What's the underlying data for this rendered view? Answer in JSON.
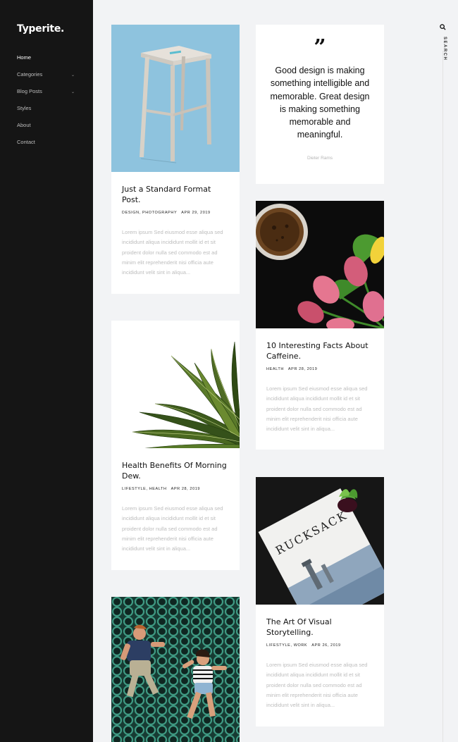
{
  "brand": {
    "logo": "Typerite."
  },
  "nav": [
    {
      "label": "Home",
      "active": true
    },
    {
      "label": "Categories",
      "chevron": "⌄"
    },
    {
      "label": "Blog Posts",
      "chevron": "⌄"
    },
    {
      "label": "Styles"
    },
    {
      "label": "About"
    },
    {
      "label": "Contact"
    }
  ],
  "search": {
    "label": "SEARCH",
    "icon": "search-icon"
  },
  "posts": [
    {
      "title": "Just a Standard Format Post.",
      "categories": "DESIGN, PHOTOGRAPHY",
      "date": "APR 29, 2019",
      "excerpt": "Lorem ipsum Sed eiusmod esse aliqua sed incididunt aliqua incididunt mollit id et sit proident dolor nulla sed commodo est ad minim elit reprehenderit nisi officia aute incididunt velit sint in aliqua..."
    },
    {
      "title": "Health Benefits Of Morning Dew.",
      "categories": "LIFESTYLE, HEALTH",
      "date": "APR 28, 2019",
      "excerpt": "Lorem ipsum Sed eiusmod esse aliqua sed incididunt aliqua incididunt mollit id et sit proident dolor nulla sed commodo est ad minim elit reprehenderit nisi officia aute incididunt velit sint in aliqua..."
    },
    {
      "title": "10 Interesting Facts About Caffeine.",
      "categories": "HEALTH",
      "date": "APR 28, 2019",
      "excerpt": "Lorem ipsum Sed eiusmod esse aliqua sed incididunt aliqua incididunt mollit id et sit proident dolor nulla sed commodo est ad minim elit reprehenderit nisi officia aute incididunt velit sint in aliqua..."
    },
    {
      "title": "The Art Of Visual Storytelling.",
      "categories": "LIFESTYLE, WORK",
      "date": "APR 26, 2019",
      "excerpt": "Lorem ipsum Sed eiusmod esse aliqua sed incididunt aliqua incididunt mollit id et sit proident dolor nulla sed commodo est ad minim elit reprehenderit nisi officia aute incididunt velit sint in aliqua..."
    }
  ],
  "quote": {
    "text": "Good design is making something intelligible and memorable. Great design is making something memorable and meaningful.",
    "author": "Dieter Rams"
  },
  "magazine": {
    "cover_text": "RUCKSACK"
  },
  "colors": {
    "sidebar": "#151515",
    "page_bg": "#f2f3f5",
    "card_bg": "#ffffff"
  }
}
